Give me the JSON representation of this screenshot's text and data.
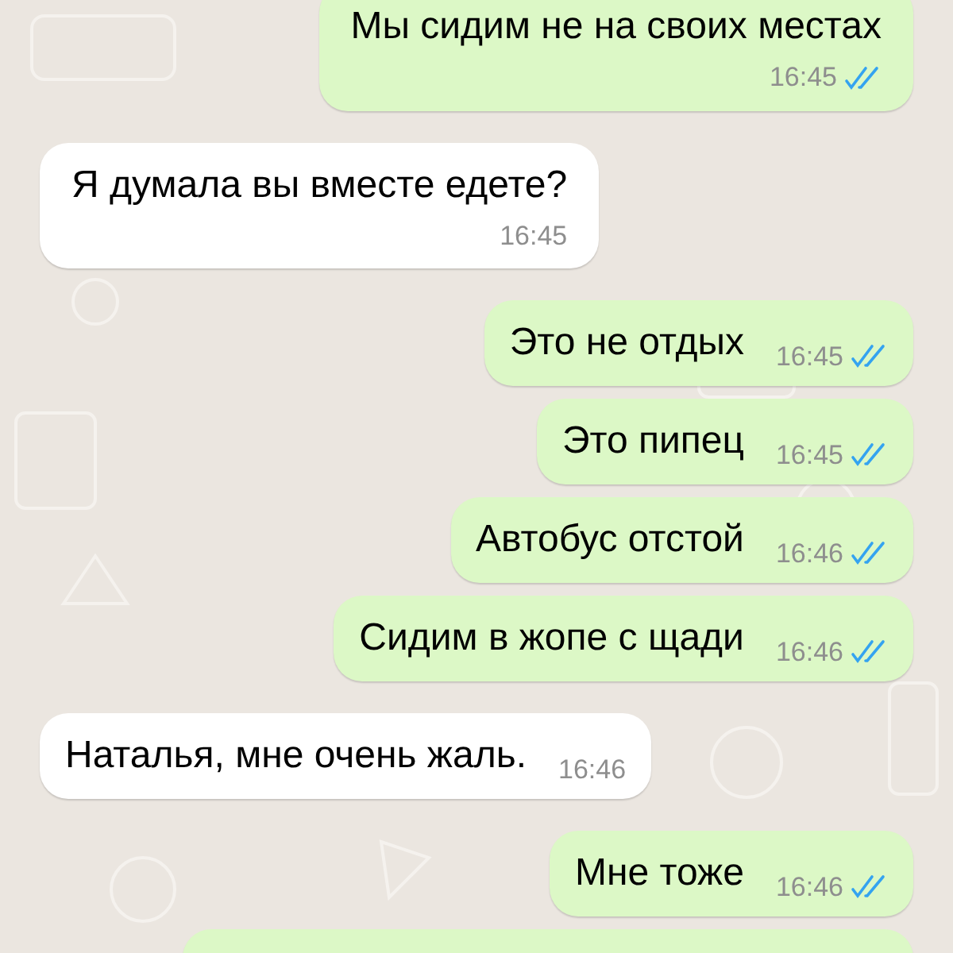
{
  "messages": [
    {
      "kind": "out-stacked",
      "text": "Мы сидим не на своих местах",
      "time": "16:45",
      "read": true
    },
    {
      "kind": "in-stacked",
      "text": "Я думала вы вместе едете?",
      "time": "16:45"
    },
    {
      "kind": "out",
      "text": "Это не отдых",
      "time": "16:45",
      "read": true
    },
    {
      "kind": "out",
      "text": "Это пипец",
      "time": "16:45",
      "read": true
    },
    {
      "kind": "out",
      "text": "Автобус отстой",
      "time": "16:46",
      "read": true
    },
    {
      "kind": "out",
      "text": "Сидим в жопе с щади",
      "time": "16:46",
      "read": true
    },
    {
      "kind": "in",
      "text": "Наталья, мне очень жаль.",
      "time": "16:46"
    },
    {
      "kind": "out",
      "text": "Мне тоже",
      "time": "16:46",
      "read": true
    },
    {
      "kind": "out-partial"
    }
  ]
}
